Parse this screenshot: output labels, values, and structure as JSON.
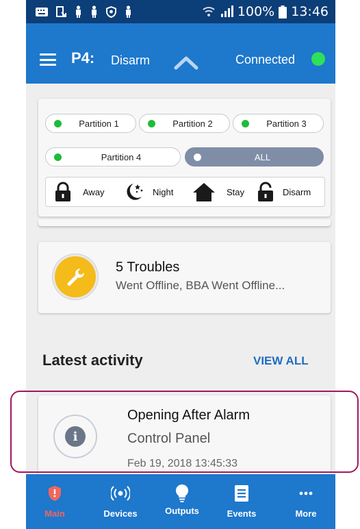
{
  "status_bar": {
    "battery": "100%",
    "time": "13:46"
  },
  "app_bar": {
    "partition": "P4:",
    "mode": "Disarm",
    "connection": "Connected",
    "connection_color": "#2ee05a"
  },
  "partitions": [
    {
      "label": "Partition 1"
    },
    {
      "label": "Partition 2"
    },
    {
      "label": "Partition 3"
    },
    {
      "label": "Partition 4"
    },
    {
      "label": "ALL"
    }
  ],
  "modes": [
    {
      "label": "Away",
      "icon": "lock-icon"
    },
    {
      "label": "Night",
      "icon": "moon-stars-icon"
    },
    {
      "label": "Stay",
      "icon": "home-icon"
    },
    {
      "label": "Disarm",
      "icon": "unlock-icon"
    }
  ],
  "troubles": {
    "title": "5 Troubles",
    "detail": "Went Offline, BBA Went Offline...",
    "icon": "wrench-icon",
    "color": "#f4bb1a"
  },
  "activity": {
    "heading": "Latest activity",
    "view_all": "VIEW ALL",
    "item": {
      "title": "Opening After Alarm",
      "source": "Control Panel",
      "timestamp": "Feb 19, 2018 13:45:33",
      "icon": "info-icon"
    }
  },
  "bottom_nav": [
    {
      "label": "Main",
      "icon": "shield-icon",
      "active": true
    },
    {
      "label": "Devices",
      "icon": "sensor-icon"
    },
    {
      "label": "Outputs",
      "icon": "bulb-icon"
    },
    {
      "label": "Events",
      "icon": "list-icon"
    },
    {
      "label": "More",
      "icon": "more-icon"
    }
  ],
  "colors": {
    "status_bar": "#0c3e78",
    "primary": "#1e78cc",
    "active_tab": "#f0675d",
    "link": "#1f6ec2",
    "highlight_border": "#a1185a"
  }
}
